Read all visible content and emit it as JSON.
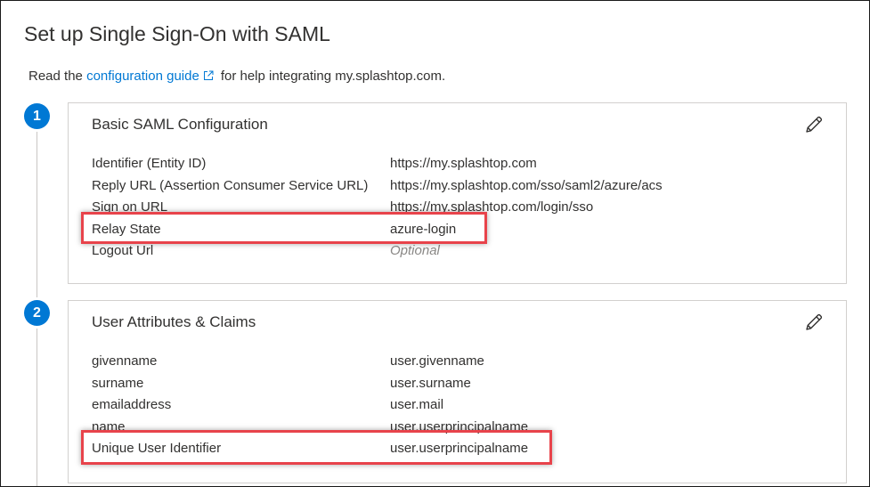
{
  "page": {
    "title": "Set up Single Sign-On with SAML",
    "intro_prefix": "Read the",
    "guide_link": "configuration guide",
    "intro_suffix": "for help integrating my.splashtop.com."
  },
  "sections": [
    {
      "step": "1",
      "title": "Basic SAML Configuration",
      "rows": [
        {
          "label": "Identifier (Entity ID)",
          "value": "https://my.splashtop.com"
        },
        {
          "label": "Reply URL (Assertion Consumer Service URL)",
          "value": "https://my.splashtop.com/sso/saml2/azure/acs"
        },
        {
          "label": "Sign on URL",
          "value": "https://my.splashtop.com/login/sso"
        },
        {
          "label": "Relay State",
          "value": "azure-login"
        },
        {
          "label": "Logout Url",
          "value": "Optional"
        }
      ]
    },
    {
      "step": "2",
      "title": "User Attributes & Claims",
      "rows": [
        {
          "label": "givenname",
          "value": "user.givenname"
        },
        {
          "label": "surname",
          "value": "user.surname"
        },
        {
          "label": "emailaddress",
          "value": "user.mail"
        },
        {
          "label": "name",
          "value": "user.userprincipalname"
        },
        {
          "label": "Unique User Identifier",
          "value": "user.userprincipalname"
        }
      ]
    }
  ],
  "icons": {
    "external_link": "external-link-icon",
    "edit": "pencil-icon"
  },
  "colors": {
    "accent": "#0078d4",
    "highlight": "#e8434b",
    "placeholder": "#8a8886"
  }
}
